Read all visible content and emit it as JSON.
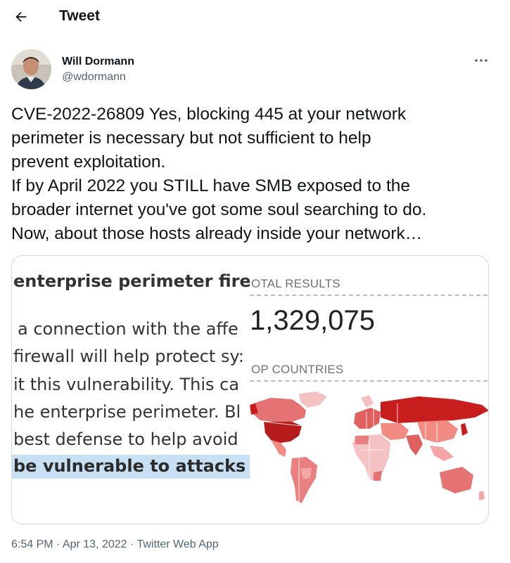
{
  "header": {
    "title": "Tweet",
    "back_icon": "arrow-left-icon"
  },
  "author": {
    "name": "Will Dormann",
    "handle": "@wdormann",
    "avatar": "avatar-photo"
  },
  "more_icon": "more-horizontal-icon",
  "tweet": {
    "lines": [
      "CVE-2022-26809 Yes, blocking 445 at your network",
      "perimeter is necessary but not sufficient to help",
      "prevent exploitation.",
      "If by April 2022 you STILL have SMB exposed to the",
      "broader internet you've got some soul searching to do.",
      "Now, about those hosts already inside your network…"
    ]
  },
  "media": {
    "doc": {
      "heading": "enterprise perimeter firev",
      "lines": [
        "a connection with the affe",
        "firewall will help protect sy:",
        "it this vulnerability. This ca",
        "he enterprise perimeter. Bl",
        "best defense to help avoid"
      ],
      "highlight": "be vulnerable to attacks f"
    },
    "stats": {
      "total_label": "OTAL RESULTS",
      "total_value": "1,329,075",
      "countries_label": "OP COUNTRIES",
      "map_icon": "world-heatmap"
    }
  },
  "footer": {
    "timestamp": "6:54 PM · Apr 13, 2022 · Twitter Web App"
  },
  "colors": {
    "text": "#0f1419",
    "secondary": "#536471",
    "highlight": "#c7e0f4",
    "map_high": "#c81e1e",
    "map_mid": "#e06060",
    "map_low": "#f4c2c2"
  }
}
